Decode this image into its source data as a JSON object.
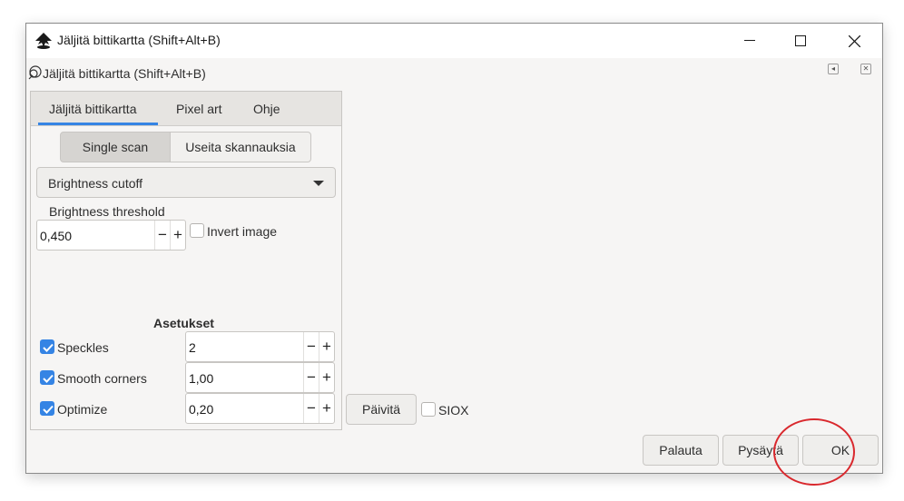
{
  "window": {
    "title": "Jäljitä bittikartta (Shift+Alt+B)",
    "controls": [
      "minimize-icon",
      "maximize-icon",
      "close-icon"
    ]
  },
  "dock": {
    "title": "Jäljitä bittikartta (Shift+Alt+B)",
    "buttons": [
      "◂",
      "✕"
    ]
  },
  "tabs": [
    {
      "label": "Jäljitä bittikartta",
      "active": true
    },
    {
      "label": "Pixel art",
      "active": false
    },
    {
      "label": "Ohje",
      "active": false
    }
  ],
  "scan_mode": {
    "single": "Single scan",
    "multi": "Useita skannauksia",
    "selected": "Single scan"
  },
  "detection": {
    "mode": "Brightness cutoff",
    "threshold_label": "Brightness threshold",
    "threshold_value": "0,450",
    "invert_label": "Invert image",
    "invert_checked": false
  },
  "settings": {
    "heading": "Asetukset",
    "speckles": {
      "label": "Speckles",
      "checked": true,
      "value": "2"
    },
    "smooth": {
      "label": "Smooth corners",
      "checked": true,
      "value": "1,00"
    },
    "optimize": {
      "label": "Optimize",
      "checked": true,
      "value": "0,20"
    }
  },
  "preview": {
    "update_label": "Päivitä",
    "siox_label": "SIOX",
    "siox_checked": false
  },
  "actions": {
    "reset": "Palauta",
    "stop": "Pysäytä",
    "ok": "OK"
  },
  "colors": {
    "accent": "#3584e4",
    "annotation": "#d9282d"
  }
}
